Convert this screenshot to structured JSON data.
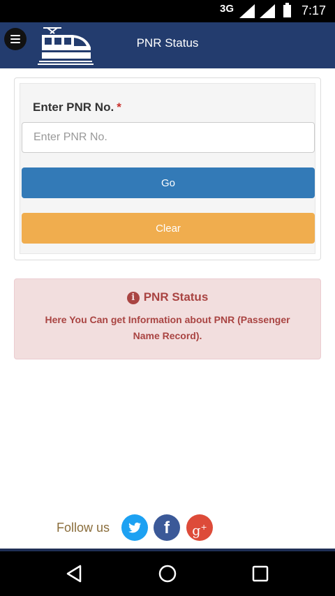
{
  "status_bar": {
    "network": "3G",
    "time": "7:17"
  },
  "app_bar": {
    "title": "PNR Status"
  },
  "form": {
    "label": "Enter PNR No.",
    "required_marker": "*",
    "input_placeholder": "Enter PNR No.",
    "input_value": "",
    "go_label": "Go",
    "clear_label": "Clear"
  },
  "info": {
    "title": "PNR Status",
    "text": "Here You Can get Information about PNR (Passenger Name Record)."
  },
  "footer": {
    "follow_label": "Follow us",
    "social": [
      "twitter-icon",
      "facebook-icon",
      "google-plus-icon"
    ]
  },
  "colors": {
    "app_bar": "#233c6e",
    "go_button": "#337ab7",
    "clear_button": "#f0ad4e",
    "alert_bg": "#f2dede",
    "alert_text": "#a94442"
  }
}
